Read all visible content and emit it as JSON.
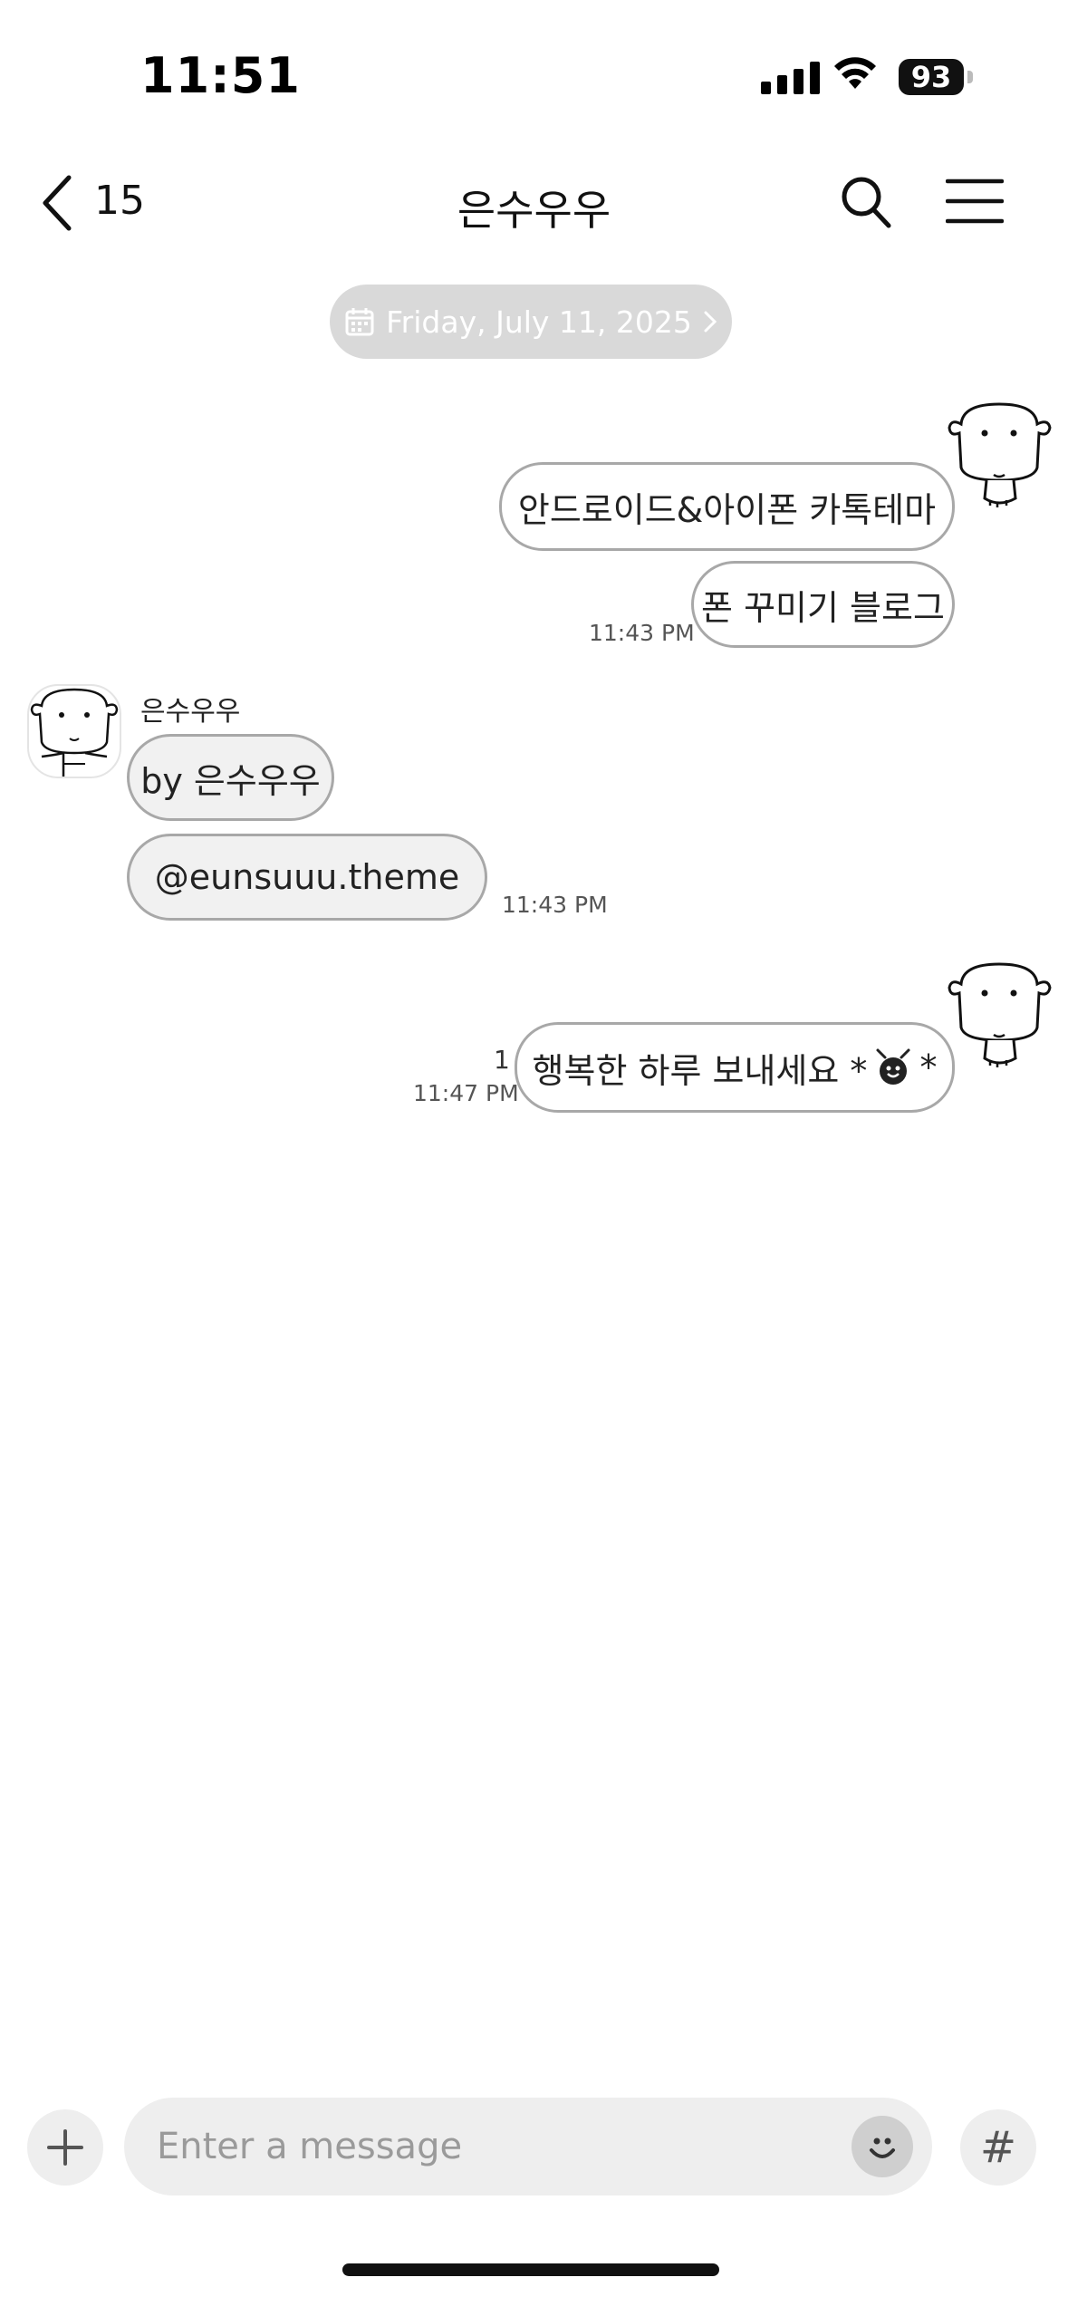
{
  "status_bar": {
    "time": "11:51",
    "battery": "93"
  },
  "header": {
    "back_count": "15",
    "title": "은수우우"
  },
  "date_pill": {
    "label": "Friday, July 11, 2025"
  },
  "messages": {
    "sent_1": {
      "line_1": "안드로이드&아이폰 카톡테마",
      "line_2": "폰 꾸미기 블로그",
      "time": "11:43 PM"
    },
    "received_1": {
      "sender": "은수우우",
      "line_1": "by 은수우우",
      "line_2": "@eunsuuu.theme",
      "time": "11:43 PM"
    },
    "sent_2": {
      "text": "행복한 하루 보내세요 *",
      "tail_text": "*",
      "unread": "1",
      "time": "11:47 PM"
    }
  },
  "input_bar": {
    "placeholder": "Enter a message",
    "hash_label": "#"
  }
}
